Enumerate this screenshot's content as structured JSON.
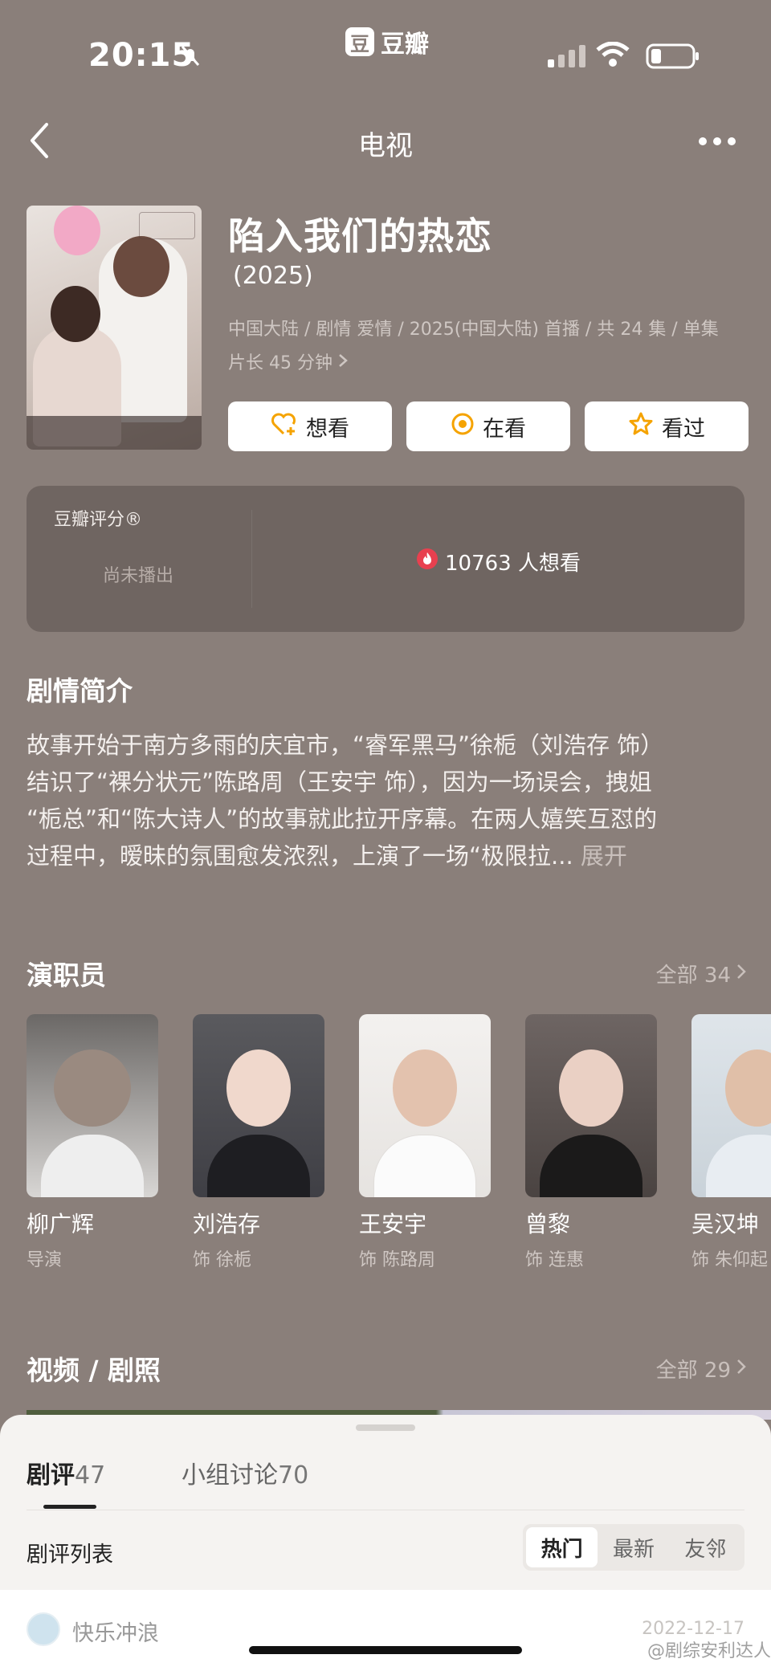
{
  "status_bar": {
    "time": "20:15",
    "app_logo": "豆",
    "app_name": "豆瓣"
  },
  "nav": {
    "title": "电视"
  },
  "show": {
    "title": "陷入我们的热恋",
    "year": "(2025)",
    "meta_line1": "中国大陆 / 剧情 爱情 / 2025(中国大陆) 首播 / 共 24 集 / 单集",
    "meta_line2": "片长 45 分钟"
  },
  "actions": {
    "want": "想看",
    "watching": "在看",
    "watched": "看过"
  },
  "rating": {
    "label": "豆瓣评分®",
    "status": "尚未播出",
    "want_count": "10763 人想看"
  },
  "synopsis": {
    "title": "剧情简介",
    "line1": "故事开始于南方多雨的庆宜市，“睿军黑马”徐栀（刘浩存 饰）",
    "line2": "结识了“裸分状元”陈路周（王安宇 饰），因为一场误会，拽姐",
    "line3": "“栀总”和“陈大诗人”的故事就此拉开序幕。在两人嬉笑互怼的",
    "line4": "过程中，暧昧的氛围愈发浓烈，上演了一场“极限拉...",
    "expand": "展开"
  },
  "cast": {
    "title": "演职员",
    "more": "全部 34",
    "members": [
      {
        "name": "柳广辉",
        "role": "导演"
      },
      {
        "name": "刘浩存",
        "role": "饰 徐栀"
      },
      {
        "name": "王安宇",
        "role": "饰 陈路周"
      },
      {
        "name": "曾黎",
        "role": "饰 连惠"
      },
      {
        "name": "吴汉坤",
        "role": "饰 朱仰起"
      }
    ]
  },
  "media": {
    "title": "视频 / 剧照",
    "more": "全部 29"
  },
  "sheet": {
    "tab_reviews_label": "剧评",
    "tab_reviews_count": "47",
    "tab_groups_label": "小组讨论",
    "tab_groups_count": "70",
    "list_title": "剧评列表",
    "sort_hot": "热门",
    "sort_new": "最新",
    "sort_friends": "友邻",
    "reviewer": "快乐冲浪",
    "review_date": "2022-12-17",
    "watermark": "@剧综安利达人"
  },
  "colors": {
    "background": "#8a7f7a",
    "accent": "#f5a300",
    "hot_red": "#e8404f"
  }
}
